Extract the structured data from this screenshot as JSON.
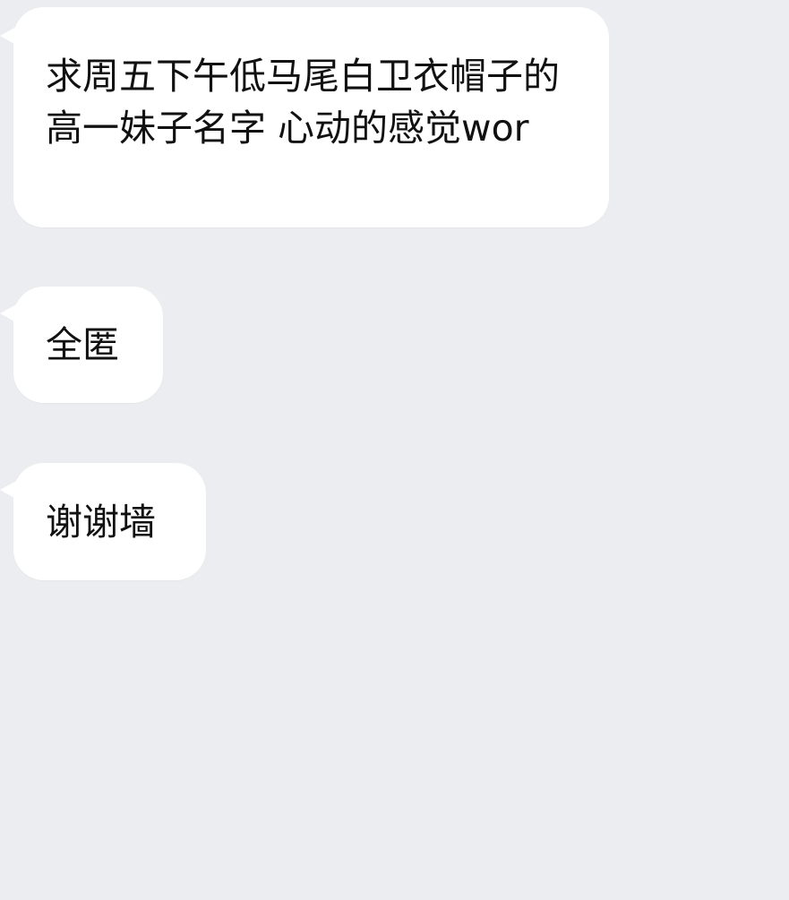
{
  "messages": [
    {
      "text": "求周五下午低马尾白卫衣帽子的高一妹子名字 心动的感觉wor"
    },
    {
      "text": "全匿"
    },
    {
      "text": "谢谢墙"
    }
  ]
}
